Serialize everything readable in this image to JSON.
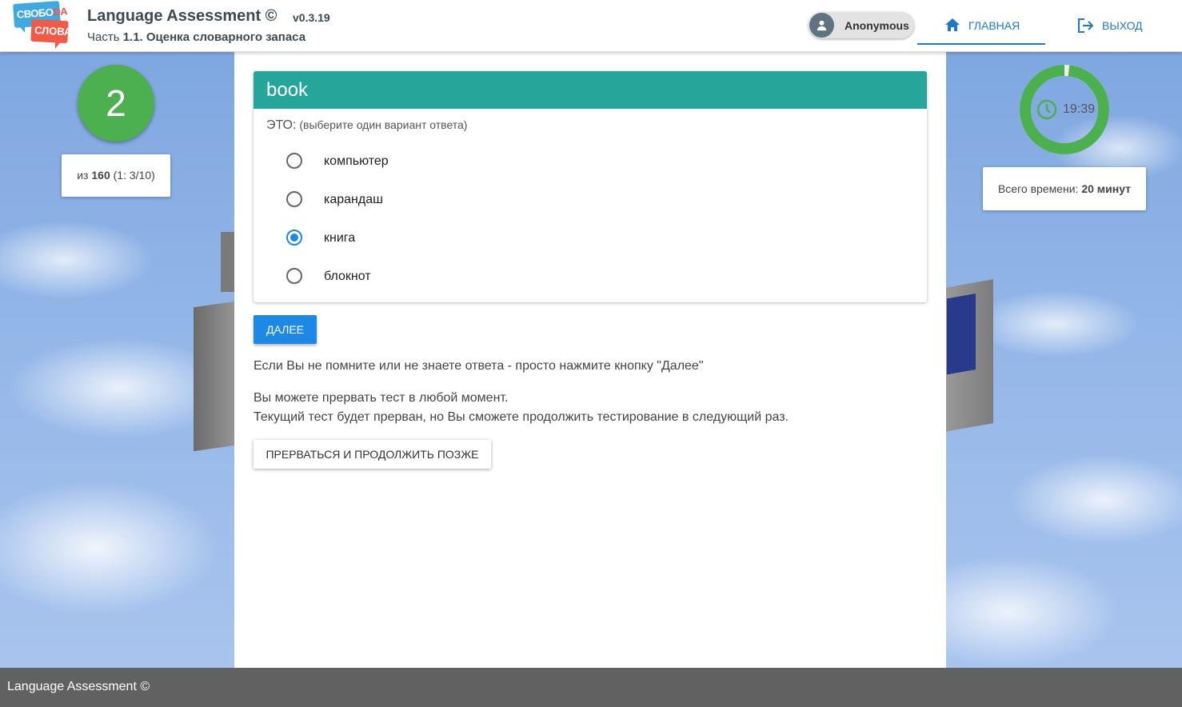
{
  "header": {
    "logo": {
      "line1_part1": "СВОБО",
      "line1_part2": "DA",
      "line2": "СЛОВА"
    },
    "title": "Language Assessment ©",
    "version": "v0.3.19",
    "subtitle_prefix": "Часть ",
    "subtitle_bold": "1.1. Оценка словарного запаса",
    "user_name": "Anonymous",
    "nav": {
      "home_label": "ГЛАВНАЯ",
      "exit_label": "ВЫХОД"
    }
  },
  "progress": {
    "question_number": "2",
    "of_prefix": "из ",
    "total": "160",
    "section_progress": " (1: 3/10)"
  },
  "timer": {
    "remaining": "19:39",
    "remaining_fraction": 0.982,
    "total_prefix": "Всего времени: ",
    "total_value": "20 минут"
  },
  "question": {
    "word": "book",
    "prompt_main": "ЭТО:",
    "prompt_hint": " (выберите один вариант ответа)",
    "options": [
      {
        "label": "компьютер",
        "selected": false
      },
      {
        "label": "карандаш",
        "selected": false
      },
      {
        "label": "книга",
        "selected": true
      },
      {
        "label": "блокнот",
        "selected": false
      }
    ]
  },
  "actions": {
    "next_label": "ДАЛЕЕ",
    "hint_text": "Если Вы не помните или не знаете ответа - просто нажмите кнопку \"Далее\"",
    "pause_line1": "Вы можете прервать тест в любой момент.",
    "pause_line2": "Текущий тест будет прерван, но Вы сможете продолжить тестирование в следующий раз.",
    "pause_label": "ПРЕРВАТЬСЯ И ПРОДОЛЖИТЬ ПОЗЖЕ"
  },
  "footer": {
    "text": "Language Assessment ©"
  },
  "colors": {
    "accent": "#1e88e5",
    "header_bar": "#26a69a",
    "progress_green": "#4caf50",
    "footer_bg": "#616161"
  }
}
